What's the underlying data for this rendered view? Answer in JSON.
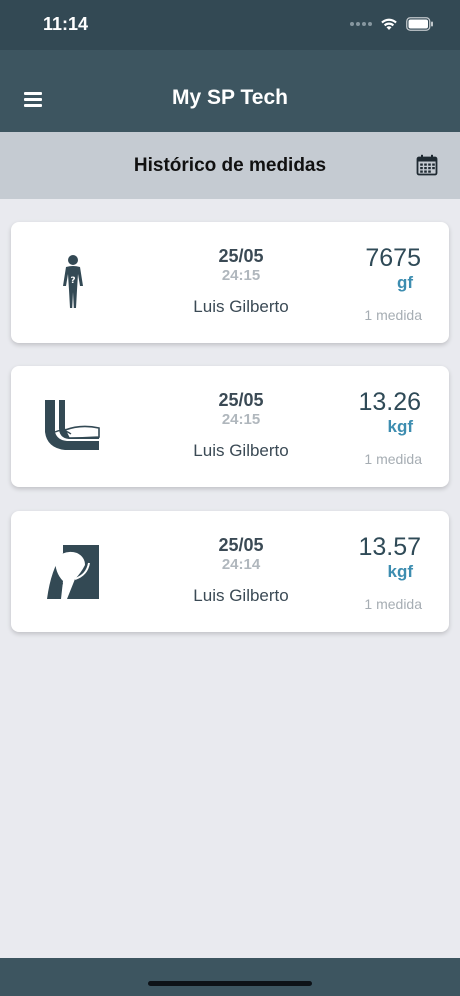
{
  "status_bar": {
    "time": "11:14"
  },
  "app_bar": {
    "title": "My SP Tech"
  },
  "subheader": {
    "title": "Histórico de medidas"
  },
  "colors": {
    "primary": "#3d5560",
    "status": "#334954",
    "accent": "#3d8db0",
    "subheader": "#c5cbd2"
  },
  "cards": [
    {
      "icon": "full-body-icon",
      "date": "25/05",
      "time": "24:15",
      "name": "Luis Gilberto",
      "value": "7675",
      "unit": "gf",
      "count": "1 medida"
    },
    {
      "icon": "elbow-icon",
      "date": "25/05",
      "time": "24:15",
      "name": "Luis Gilberto",
      "value": "13.26",
      "unit": "kgf",
      "count": "1 medida"
    },
    {
      "icon": "shoulder-icon",
      "date": "25/05",
      "time": "24:14",
      "name": "Luis Gilberto",
      "value": "13.57",
      "unit": "kgf",
      "count": "1 medida"
    }
  ]
}
